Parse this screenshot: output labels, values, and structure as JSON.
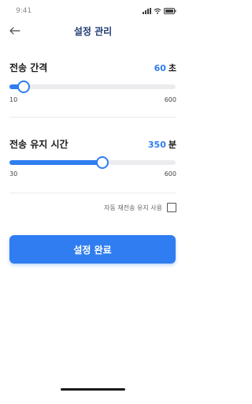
{
  "status_bar": {
    "time": "9:41"
  },
  "header": {
    "title": "설정 관리",
    "back_icon": "arrow-left-icon"
  },
  "settings": [
    {
      "label": "전송 간격",
      "value": "60",
      "unit": "초",
      "min": 10,
      "max": 600,
      "min_label": "10",
      "max_label": "600",
      "current": 60
    },
    {
      "label": "전송 유지 시간",
      "value": "350",
      "unit": "분",
      "min": 30,
      "max": 600,
      "min_label": "30",
      "max_label": "600",
      "current": 350
    }
  ],
  "auto_resend": {
    "label": "자동 재전송 유지 사용",
    "checked": false
  },
  "confirm_button": {
    "label": "설정 완료"
  },
  "colors": {
    "accent": "#2f7df0",
    "title": "#1f3b73",
    "track": "#ececef"
  }
}
